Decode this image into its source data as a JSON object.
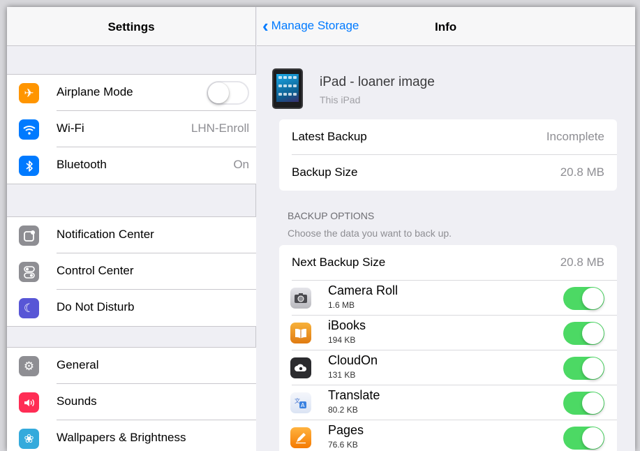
{
  "left": {
    "title": "Settings",
    "group1": [
      {
        "label": "Airplane Mode",
        "icon": "airplane-icon",
        "color": "#ff9500",
        "toggle": false
      },
      {
        "label": "Wi-Fi",
        "value": "LHN-Enroll",
        "icon": "wifi-icon",
        "color": "#007aff"
      },
      {
        "label": "Bluetooth",
        "value": "On",
        "icon": "bluetooth-icon",
        "color": "#007aff"
      }
    ],
    "group2": [
      {
        "label": "Notification Center",
        "icon": "notification-center-icon",
        "color": "#8e8e93"
      },
      {
        "label": "Control Center",
        "icon": "control-center-icon",
        "color": "#8e8e93"
      },
      {
        "label": "Do Not Disturb",
        "icon": "moon-icon",
        "color": "#5856d6"
      }
    ],
    "group3": [
      {
        "label": "General",
        "icon": "gear-icon",
        "color": "#8e8e93"
      },
      {
        "label": "Sounds",
        "icon": "speaker-icon",
        "color": "#ff2d55"
      },
      {
        "label": "Wallpapers & Brightness",
        "icon": "flower-icon",
        "color": "#34aadc"
      }
    ]
  },
  "right": {
    "back_label": "Manage Storage",
    "title": "Info",
    "device": {
      "name": "iPad - loaner image",
      "subtitle": "This iPad"
    },
    "backup": [
      {
        "label": "Latest Backup",
        "value": "Incomplete"
      },
      {
        "label": "Backup Size",
        "value": "20.8 MB"
      }
    ],
    "options": {
      "header": "BACKUP OPTIONS",
      "footer": "Choose the data you want to back up.",
      "next_label": "Next Backup Size",
      "next_value": "20.8 MB",
      "apps": [
        {
          "name": "Camera Roll",
          "size": "1.6 MB",
          "icon": "camera-icon",
          "on": true
        },
        {
          "name": "iBooks",
          "size": "194 KB",
          "icon": "ibooks-icon",
          "on": true
        },
        {
          "name": "CloudOn",
          "size": "131 KB",
          "icon": "cloudon-icon",
          "on": true
        },
        {
          "name": "Translate",
          "size": "80.2 KB",
          "icon": "translate-icon",
          "on": true
        },
        {
          "name": "Pages",
          "size": "76.6 KB",
          "icon": "pages-icon",
          "on": true
        }
      ]
    }
  },
  "colors": {
    "accent": "#007aff",
    "toggle_on": "#4cd964"
  }
}
